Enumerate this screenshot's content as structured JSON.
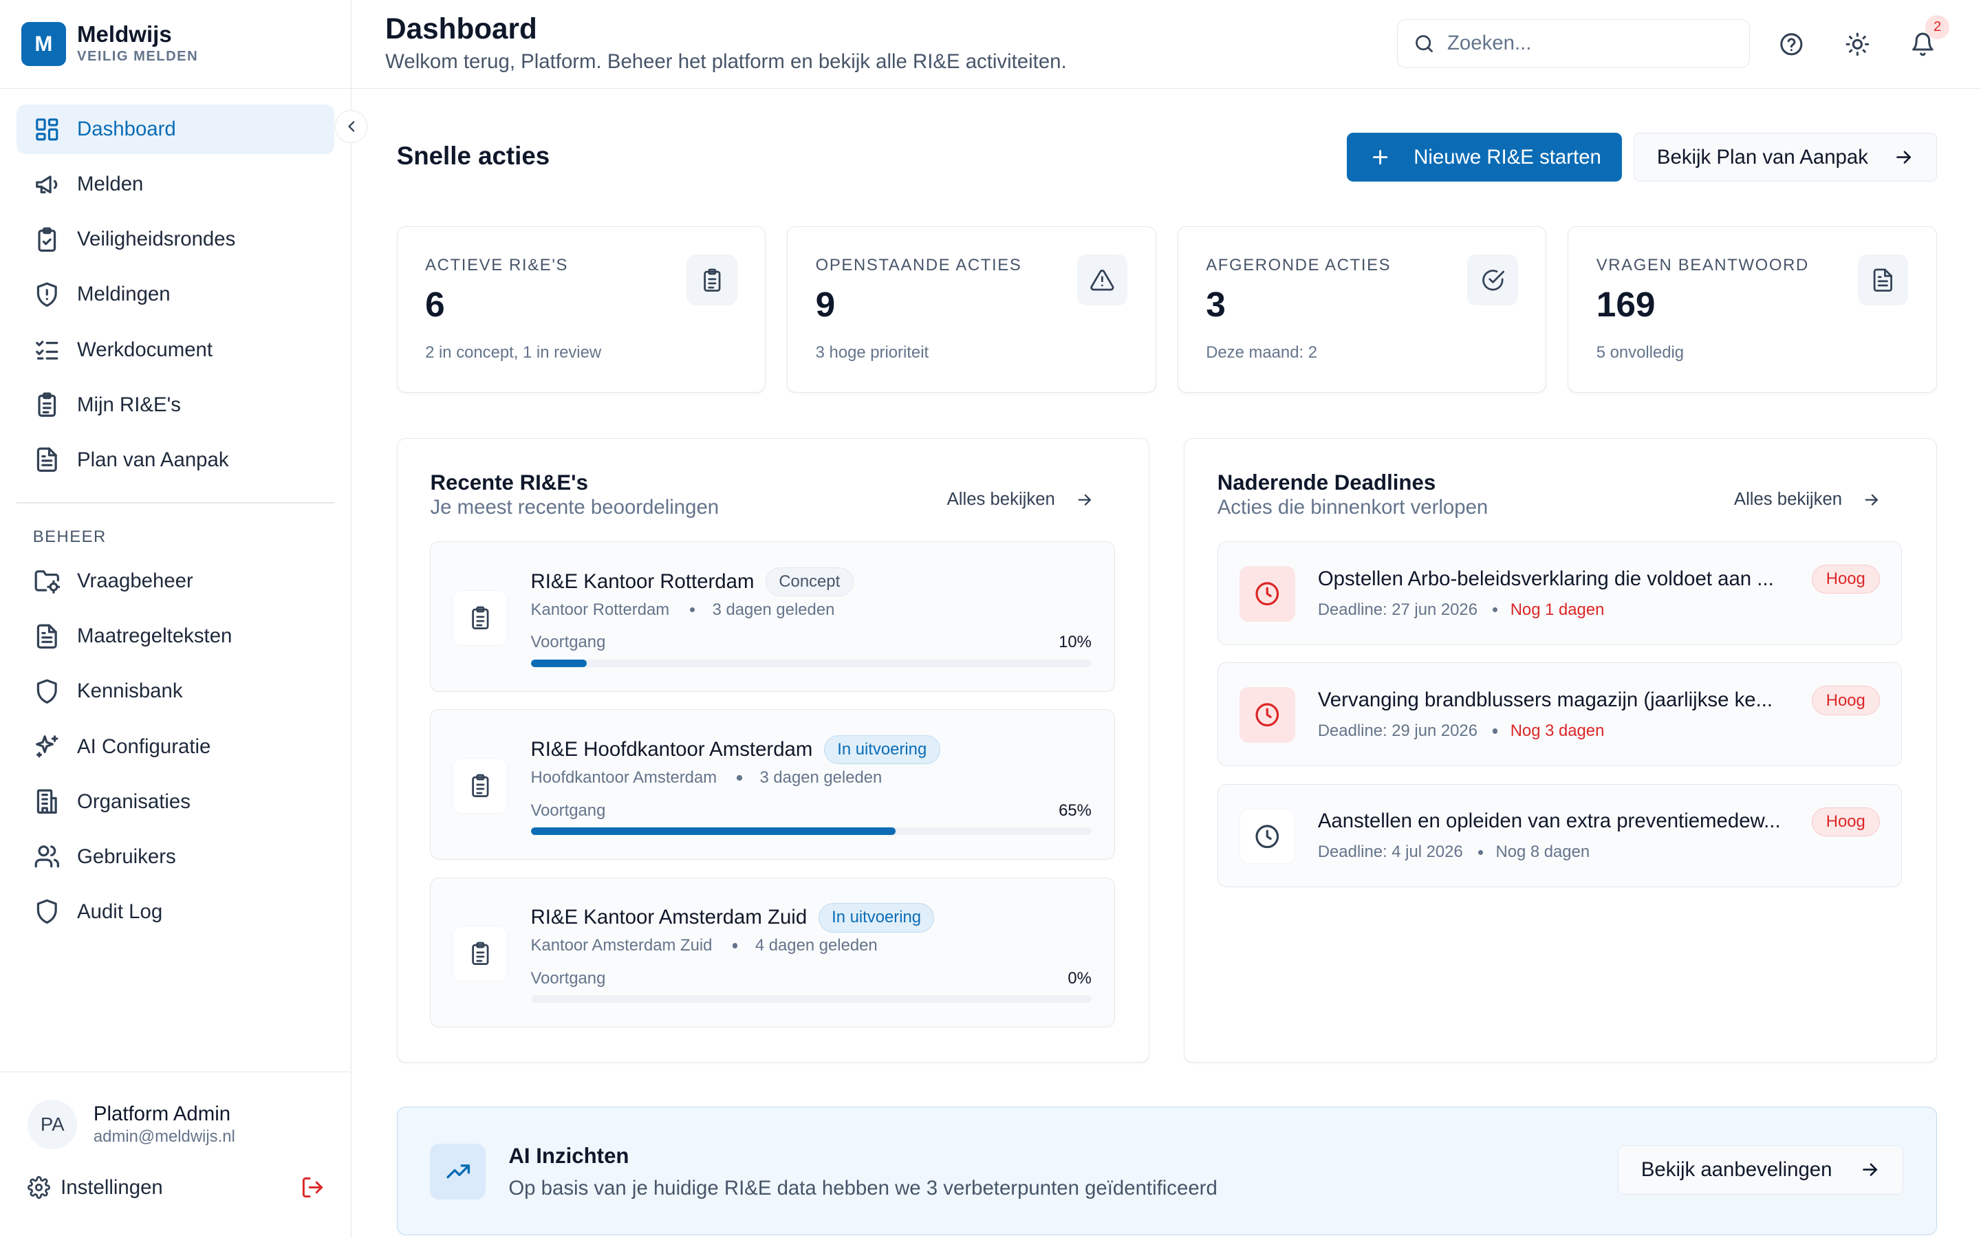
{
  "brand": {
    "logo_letter": "M",
    "name": "Meldwijs",
    "tagline": "VEILIG MELDEN"
  },
  "sidebar": {
    "items": [
      {
        "label": "Dashboard",
        "icon": "dashboard-icon",
        "active": true
      },
      {
        "label": "Melden",
        "icon": "megaphone-icon"
      },
      {
        "label": "Veiligheidsrondes",
        "icon": "clipboard-check-icon"
      },
      {
        "label": "Meldingen",
        "icon": "shield-alert-icon"
      },
      {
        "label": "Werkdocument",
        "icon": "list-checks-icon"
      },
      {
        "label": "Mijn RI&E's",
        "icon": "clipboard-list-icon"
      },
      {
        "label": "Plan van Aanpak",
        "icon": "file-text-icon"
      }
    ],
    "section_label": "BEHEER",
    "admin_items": [
      {
        "label": "Vraagbeheer",
        "icon": "folder-cog-icon"
      },
      {
        "label": "Maatregelteksten",
        "icon": "file-text-icon"
      },
      {
        "label": "Kennisbank",
        "icon": "shield-icon"
      },
      {
        "label": "AI Configuratie",
        "icon": "sparkles-icon"
      },
      {
        "label": "Organisaties",
        "icon": "building-icon"
      },
      {
        "label": "Gebruikers",
        "icon": "users-icon"
      },
      {
        "label": "Audit Log",
        "icon": "shield-icon"
      }
    ],
    "user": {
      "initials": "PA",
      "name": "Platform Admin",
      "email": "admin@meldwijs.nl"
    },
    "settings_label": "Instellingen"
  },
  "header": {
    "title": "Dashboard",
    "subtitle": "Welkom terug, Platform. Beheer het platform en bekijk alle RI&E activiteiten.",
    "search_placeholder": "Zoeken...",
    "notification_count": "2"
  },
  "quick_actions": {
    "title": "Snelle acties",
    "primary_label": "Nieuwe RI&E starten",
    "secondary_label": "Bekijk Plan van Aanpak"
  },
  "stats": [
    {
      "label": "ACTIEVE RI&E'S",
      "value": "6",
      "note": "2 in concept, 1 in review",
      "icon": "clipboard-list-icon"
    },
    {
      "label": "OPENSTAANDE ACTIES",
      "value": "9",
      "note": "3 hoge prioriteit",
      "icon": "alert-triangle-icon"
    },
    {
      "label": "AFGERONDE ACTIES",
      "value": "3",
      "note": "Deze maand: 2",
      "icon": "check-circle-icon"
    },
    {
      "label": "VRAGEN BEANTWOORD",
      "value": "169",
      "note": "5 onvolledig",
      "icon": "file-text-icon"
    }
  ],
  "recent": {
    "title": "Recente RI&E's",
    "subtitle": "Je meest recente beoordelingen",
    "link": "Alles bekijken",
    "progress_label": "Voortgang",
    "items": [
      {
        "title": "RI&E Kantoor Rotterdam",
        "status": "Concept",
        "location": "Kantoor Rotterdam",
        "time": "3 dagen geleden",
        "progress_text": "10%",
        "progress": 10
      },
      {
        "title": "RI&E Hoofdkantoor Amsterdam",
        "status": "In uitvoering",
        "location": "Hoofdkantoor Amsterdam",
        "time": "3 dagen geleden",
        "progress_text": "65%",
        "progress": 65
      },
      {
        "title": "RI&E Kantoor Amsterdam Zuid",
        "status": "In uitvoering",
        "location": "Kantoor Amsterdam Zuid",
        "time": "4 dagen geleden",
        "progress_text": "0%",
        "progress": 0
      }
    ]
  },
  "deadlines": {
    "title": "Naderende Deadlines",
    "subtitle": "Acties die binnenkort verlopen",
    "link": "Alles bekijken",
    "items": [
      {
        "title": "Opstellen Arbo-beleidsverklaring die voldoet aan ...",
        "priority": "Hoog",
        "deadline": "Deadline: 27 jun 2026",
        "remaining": "Nog 1 dagen",
        "urgent": true
      },
      {
        "title": "Vervanging brandblussers magazijn (jaarlijkse ke...",
        "priority": "Hoog",
        "deadline": "Deadline: 29 jun 2026",
        "remaining": "Nog 3 dagen",
        "urgent": true
      },
      {
        "title": "Aanstellen en opleiden van extra preventiemedew...",
        "priority": "Hoog",
        "deadline": "Deadline: 4 jul 2026",
        "remaining": "Nog 8 dagen",
        "urgent": false
      }
    ]
  },
  "insights": {
    "title": "AI Inzichten",
    "subtitle": "Op basis van je huidige RI&E data hebben we 3 verbeterpunten geïdentificeerd",
    "button": "Bekijk aanbevelingen"
  },
  "colors": {
    "primary": "#0b6cb5",
    "danger": "#dc2626",
    "border": "#e5e7eb",
    "muted": "#64748b"
  }
}
